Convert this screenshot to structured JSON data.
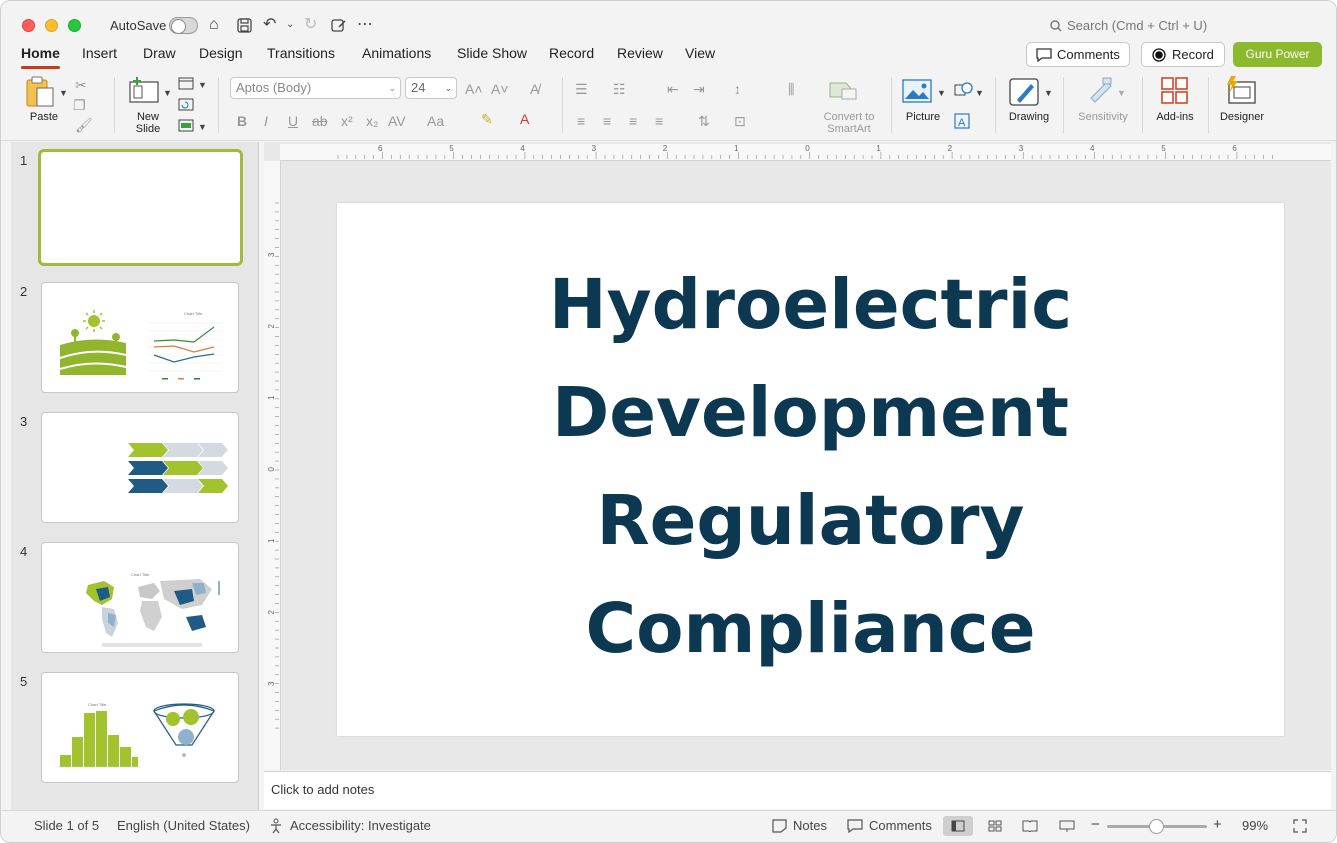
{
  "titlebar": {
    "autosave_label": "AutoSave",
    "search_placeholder": "Search (Cmd + Ctrl + U)"
  },
  "tabs": [
    "Home",
    "Insert",
    "Draw",
    "Design",
    "Transitions",
    "Animations",
    "Slide Show",
    "Record",
    "Review",
    "View"
  ],
  "active_tab": "Home",
  "actions": {
    "comments": "Comments",
    "record": "Record",
    "guru": "Guru Power"
  },
  "ribbon": {
    "paste": "Paste",
    "new_slide_1": "New",
    "new_slide_2": "Slide",
    "font": "Aptos (Body)",
    "size": "24",
    "convert_1": "Convert to",
    "convert_2": "SmartArt",
    "picture": "Picture",
    "drawing": "Drawing",
    "sensitivity": "Sensitivity",
    "addins": "Add-ins",
    "designer": "Designer"
  },
  "slides": {
    "numbers": [
      "1",
      "2",
      "3",
      "4",
      "5"
    ],
    "thumb4_title": "Chart Title",
    "thumb5_title": "Chart Title"
  },
  "slide": {
    "title_lines": [
      "Hydroelectric",
      "Development",
      "Regulatory",
      "Compliance"
    ]
  },
  "notes": {
    "placeholder": "Click to add notes"
  },
  "status": {
    "slide_of": "Slide 1 of 5",
    "language": "English (United States)",
    "accessibility": "Accessibility: Investigate",
    "notes": "Notes",
    "comments": "Comments",
    "zoom": "99%"
  },
  "ruler": {
    "h_labels": [
      "6",
      "5",
      "4",
      "3",
      "2",
      "1",
      "0",
      "1",
      "2",
      "3",
      "4",
      "5",
      "6"
    ],
    "v_labels": [
      "3",
      "2",
      "1",
      "0",
      "1",
      "2",
      "3"
    ]
  },
  "colors": {
    "title": "#0c3851",
    "accent_green": "#8db92e",
    "accent_blue": "#1f5b85",
    "tab_underline": "#c43e1c"
  }
}
